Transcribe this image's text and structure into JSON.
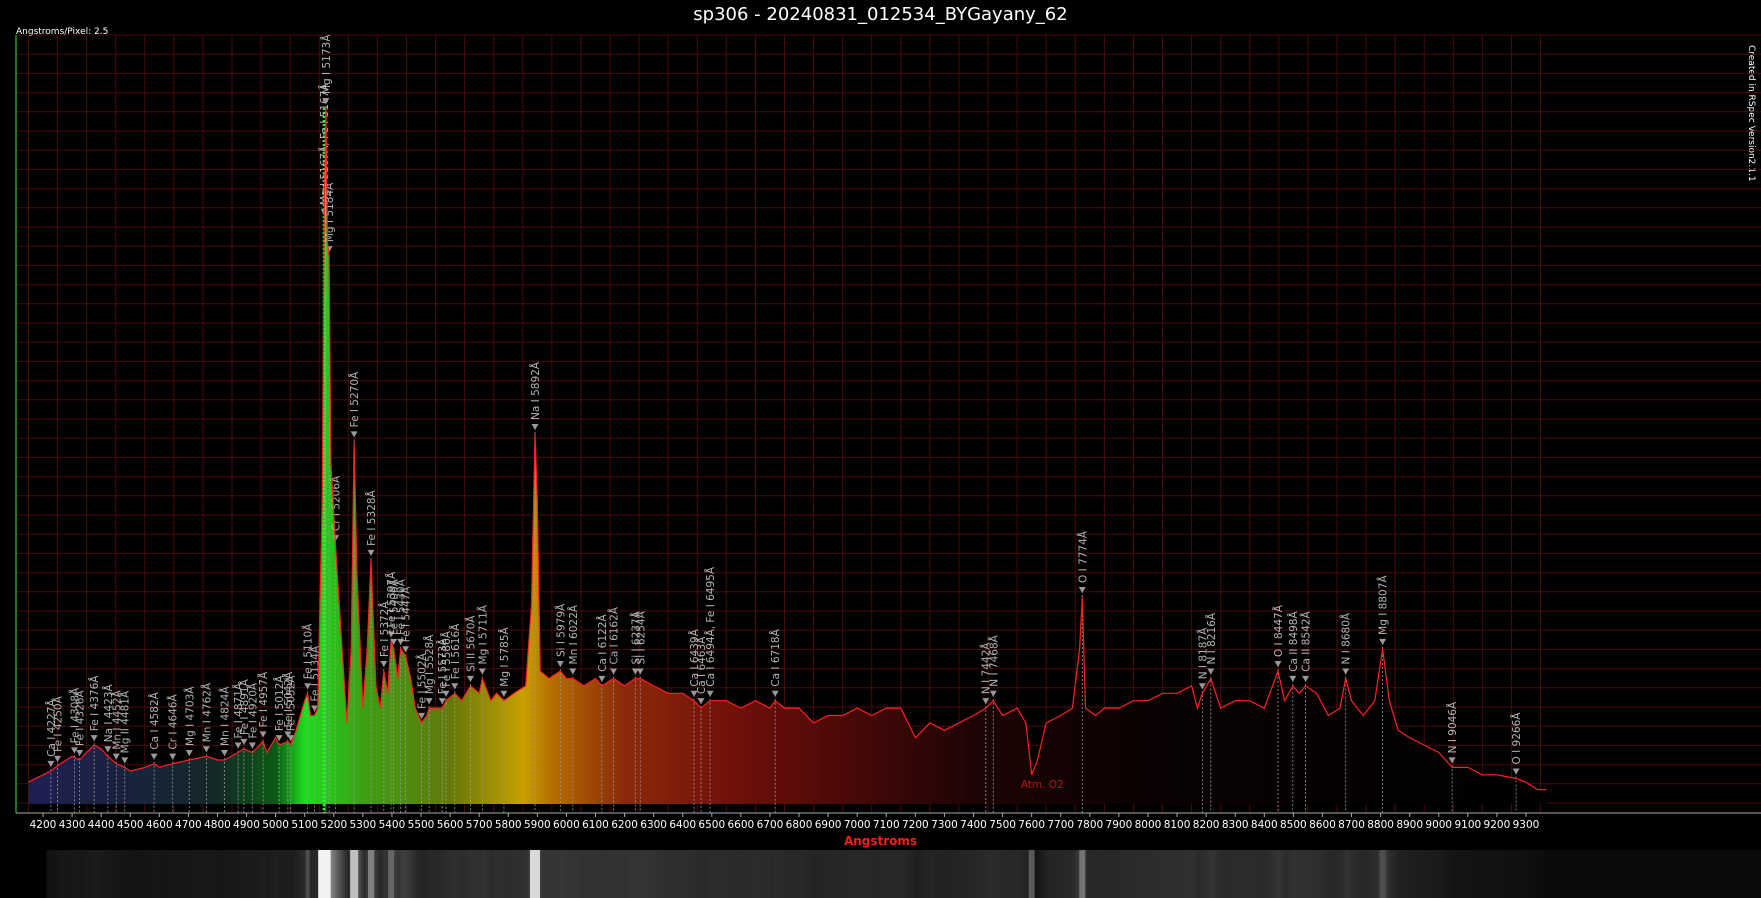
{
  "chart_data": {
    "type": "line",
    "title": "sp306 - 20240831_012534_BYGayany_62",
    "scale_label": "Angstroms/Pixel: 2.5",
    "credit": "Created in RSpec Version2.1.1",
    "xlabel": "Angstroms",
    "ylabel": "",
    "xlim": [
      4200,
      9380
    ],
    "ylim": [
      0,
      1
    ],
    "grid": true,
    "x_ticks": [
      4200,
      4300,
      4400,
      4500,
      4600,
      4700,
      4800,
      4900,
      5000,
      5100,
      5200,
      5300,
      5400,
      5500,
      5600,
      5700,
      5800,
      5900,
      6000,
      6100,
      6200,
      6300,
      6400,
      6500,
      6600,
      6700,
      6800,
      6900,
      7000,
      7100,
      7200,
      7300,
      7400,
      7500,
      7600,
      7700,
      7800,
      7900,
      8000,
      8100,
      8200,
      8300,
      8400,
      8500,
      8600,
      8700,
      8800,
      8900,
      9000,
      9100,
      9200,
      9300
    ],
    "series": [
      {
        "color": "#ff2020",
        "points": [
          [
            4150,
            0.02
          ],
          [
            4200,
            0.03
          ],
          [
            4226,
            0.035
          ],
          [
            4260,
            0.045
          ],
          [
            4300,
            0.055
          ],
          [
            4326,
            0.05
          ],
          [
            4350,
            0.06
          ],
          [
            4376,
            0.07
          ],
          [
            4400,
            0.065
          ],
          [
            4423,
            0.055
          ],
          [
            4452,
            0.045
          ],
          [
            4481,
            0.04
          ],
          [
            4500,
            0.035
          ],
          [
            4550,
            0.04
          ],
          [
            4582,
            0.045
          ],
          [
            4600,
            0.04
          ],
          [
            4646,
            0.045
          ],
          [
            4703,
            0.05
          ],
          [
            4762,
            0.055
          ],
          [
            4800,
            0.05
          ],
          [
            4824,
            0.05
          ],
          [
            4871,
            0.06
          ],
          [
            4891,
            0.065
          ],
          [
            4920,
            0.06
          ],
          [
            4957,
            0.075
          ],
          [
            4970,
            0.06
          ],
          [
            5000,
            0.08
          ],
          [
            5012,
            0.07
          ],
          [
            5042,
            0.075
          ],
          [
            5052,
            0.07
          ],
          [
            5070,
            0.09
          ],
          [
            5100,
            0.13
          ],
          [
            5110,
            0.14
          ],
          [
            5120,
            0.11
          ],
          [
            5134,
            0.11
          ],
          [
            5145,
            0.12
          ],
          [
            5160,
            0.4
          ],
          [
            5167,
            0.78
          ],
          [
            5173,
            0.93
          ],
          [
            5178,
            0.75
          ],
          [
            5184,
            0.73
          ],
          [
            5190,
            0.45
          ],
          [
            5206,
            0.34
          ],
          [
            5225,
            0.22
          ],
          [
            5245,
            0.1
          ],
          [
            5260,
            0.2
          ],
          [
            5270,
            0.48
          ],
          [
            5280,
            0.3
          ],
          [
            5300,
            0.12
          ],
          [
            5315,
            0.2
          ],
          [
            5328,
            0.32
          ],
          [
            5345,
            0.15
          ],
          [
            5360,
            0.12
          ],
          [
            5372,
            0.17
          ],
          [
            5385,
            0.14
          ],
          [
            5397,
            0.21
          ],
          [
            5406,
            0.2
          ],
          [
            5420,
            0.16
          ],
          [
            5430,
            0.2
          ],
          [
            5447,
            0.19
          ],
          [
            5465,
            0.16
          ],
          [
            5480,
            0.12
          ],
          [
            5502,
            0.1
          ],
          [
            5520,
            0.11
          ],
          [
            5528,
            0.12
          ],
          [
            5550,
            0.12
          ],
          [
            5573,
            0.12
          ],
          [
            5586,
            0.13
          ],
          [
            5616,
            0.14
          ],
          [
            5640,
            0.13
          ],
          [
            5670,
            0.15
          ],
          [
            5700,
            0.14
          ],
          [
            5711,
            0.16
          ],
          [
            5740,
            0.13
          ],
          [
            5760,
            0.14
          ],
          [
            5785,
            0.13
          ],
          [
            5820,
            0.14
          ],
          [
            5860,
            0.15
          ],
          [
            5880,
            0.26
          ],
          [
            5892,
            0.49
          ],
          [
            5900,
            0.4
          ],
          [
            5910,
            0.17
          ],
          [
            5940,
            0.16
          ],
          [
            5979,
            0.17
          ],
          [
            6000,
            0.16
          ],
          [
            6022,
            0.16
          ],
          [
            6060,
            0.15
          ],
          [
            6100,
            0.16
          ],
          [
            6122,
            0.15
          ],
          [
            6162,
            0.16
          ],
          [
            6200,
            0.15
          ],
          [
            6237,
            0.16
          ],
          [
            6254,
            0.16
          ],
          [
            6300,
            0.15
          ],
          [
            6350,
            0.14
          ],
          [
            6400,
            0.14
          ],
          [
            6439,
            0.13
          ],
          [
            6463,
            0.12
          ],
          [
            6494,
            0.13
          ],
          [
            6550,
            0.13
          ],
          [
            6600,
            0.12
          ],
          [
            6650,
            0.13
          ],
          [
            6700,
            0.12
          ],
          [
            6718,
            0.13
          ],
          [
            6750,
            0.12
          ],
          [
            6800,
            0.12
          ],
          [
            6850,
            0.1
          ],
          [
            6900,
            0.11
          ],
          [
            6950,
            0.11
          ],
          [
            7000,
            0.12
          ],
          [
            7050,
            0.11
          ],
          [
            7100,
            0.12
          ],
          [
            7150,
            0.12
          ],
          [
            7200,
            0.08
          ],
          [
            7250,
            0.1
          ],
          [
            7300,
            0.09
          ],
          [
            7350,
            0.1
          ],
          [
            7400,
            0.11
          ],
          [
            7442,
            0.12
          ],
          [
            7468,
            0.13
          ],
          [
            7500,
            0.11
          ],
          [
            7550,
            0.12
          ],
          [
            7580,
            0.1
          ],
          [
            7600,
            0.03
          ],
          [
            7620,
            0.05
          ],
          [
            7650,
            0.1
          ],
          [
            7700,
            0.11
          ],
          [
            7740,
            0.12
          ],
          [
            7765,
            0.2
          ],
          [
            7774,
            0.27
          ],
          [
            7785,
            0.12
          ],
          [
            7820,
            0.11
          ],
          [
            7850,
            0.12
          ],
          [
            7900,
            0.12
          ],
          [
            7950,
            0.13
          ],
          [
            8000,
            0.13
          ],
          [
            8050,
            0.14
          ],
          [
            8100,
            0.14
          ],
          [
            8150,
            0.15
          ],
          [
            8170,
            0.12
          ],
          [
            8187,
            0.14
          ],
          [
            8216,
            0.16
          ],
          [
            8250,
            0.12
          ],
          [
            8300,
            0.13
          ],
          [
            8350,
            0.13
          ],
          [
            8400,
            0.12
          ],
          [
            8447,
            0.17
          ],
          [
            8470,
            0.13
          ],
          [
            8498,
            0.15
          ],
          [
            8520,
            0.14
          ],
          [
            8542,
            0.15
          ],
          [
            8580,
            0.14
          ],
          [
            8620,
            0.11
          ],
          [
            8660,
            0.12
          ],
          [
            8680,
            0.16
          ],
          [
            8700,
            0.13
          ],
          [
            8740,
            0.11
          ],
          [
            8780,
            0.13
          ],
          [
            8807,
            0.2
          ],
          [
            8830,
            0.13
          ],
          [
            8860,
            0.09
          ],
          [
            8900,
            0.08
          ],
          [
            8950,
            0.07
          ],
          [
            9000,
            0.06
          ],
          [
            9046,
            0.04
          ],
          [
            9100,
            0.04
          ],
          [
            9150,
            0.03
          ],
          [
            9200,
            0.03
          ],
          [
            9266,
            0.025
          ],
          [
            9300,
            0.02
          ],
          [
            9340,
            0.01
          ],
          [
            9370,
            0.01
          ]
        ]
      }
    ],
    "annotations": [
      {
        "x": 4227,
        "label": "Ca I 4227Å"
      },
      {
        "x": 4250,
        "label": "Fe I 4250Å"
      },
      {
        "x": 4308,
        "label": "Fe I 4308Å"
      },
      {
        "x": 4326,
        "label": "Fe I 4326Å"
      },
      {
        "x": 4376,
        "label": "Fe I 4376Å"
      },
      {
        "x": 4423,
        "label": "Na I 4423Å"
      },
      {
        "x": 4452,
        "label": "Mn I 4452Å"
      },
      {
        "x": 4481,
        "label": "Mg II 4481Å"
      },
      {
        "x": 4582,
        "label": "Ca I 4582Å"
      },
      {
        "x": 4646,
        "label": "Cr I 4646Å"
      },
      {
        "x": 4703,
        "label": "Mg I 4703Å"
      },
      {
        "x": 4762,
        "label": "Mn I 4762Å"
      },
      {
        "x": 4824,
        "label": "Mn I 4824Å"
      },
      {
        "x": 4871,
        "label": "Fe I 4871Å"
      },
      {
        "x": 4891,
        "label": "Fe I 4891Å"
      },
      {
        "x": 4920,
        "label": "Fe I 4920Å"
      },
      {
        "x": 4957,
        "label": "Fe I 4957Å"
      },
      {
        "x": 5012,
        "label": "Fe I 5012Å"
      },
      {
        "x": 5042,
        "label": "Fe I 5042Å"
      },
      {
        "x": 5052,
        "label": "Fe I 5052Å"
      },
      {
        "x": 5110,
        "label": "Fe I 5110Å"
      },
      {
        "x": 5134,
        "label": "Fe I 5134Å"
      },
      {
        "x": 5167,
        "label": "Mg I 5167Å, Fe I 5167Å"
      },
      {
        "x": 5173,
        "label": "Mg I 5173Å"
      },
      {
        "x": 5184,
        "label": "Mg I 5184Å"
      },
      {
        "x": 5206,
        "label": "Cr I 5206Å"
      },
      {
        "x": 5270,
        "label": "Fe I 5270Å"
      },
      {
        "x": 5328,
        "label": "Fe I 5328Å"
      },
      {
        "x": 5372,
        "label": "Fe I 5372Å"
      },
      {
        "x": 5397,
        "label": "Fe I 5397Å"
      },
      {
        "x": 5406,
        "label": "Fe I 5406Å"
      },
      {
        "x": 5430,
        "label": "Fe I 5430Å"
      },
      {
        "x": 5447,
        "label": "Fe I 5447Å"
      },
      {
        "x": 5502,
        "label": "Fe I 5502Å"
      },
      {
        "x": 5528,
        "label": "Mg I 5528Å"
      },
      {
        "x": 5573,
        "label": "Fe I 5573Å"
      },
      {
        "x": 5586,
        "label": "Fe I 5586Å"
      },
      {
        "x": 5616,
        "label": "Fe I 5616Å"
      },
      {
        "x": 5670,
        "label": "Si II 5670Å"
      },
      {
        "x": 5711,
        "label": "Mg I 5711Å"
      },
      {
        "x": 5785,
        "label": "Mg I 5785Å"
      },
      {
        "x": 5892,
        "label": "Na I 5892Å"
      },
      {
        "x": 5979,
        "label": "Si I 5979Å"
      },
      {
        "x": 6022,
        "label": "Mn I 6022Å"
      },
      {
        "x": 6122,
        "label": "Ca I 6122Å"
      },
      {
        "x": 6162,
        "label": "Ca I 6162Å"
      },
      {
        "x": 6237,
        "label": "Si I 6237Å"
      },
      {
        "x": 6254,
        "label": "Si I 6254Å"
      },
      {
        "x": 6439,
        "label": "Ca I 6439Å"
      },
      {
        "x": 6463,
        "label": "Ca I 6463Å"
      },
      {
        "x": 6494,
        "label": "Ca I 6494Å, Fe I 6495Å"
      },
      {
        "x": 6718,
        "label": "Ca I 6718Å"
      },
      {
        "x": 7442,
        "label": "N I 7442Å"
      },
      {
        "x": 7468,
        "label": "N I 7468Å"
      },
      {
        "x": 7774,
        "label": "O I 7774Å"
      },
      {
        "x": 8187,
        "label": "N I 8187Å"
      },
      {
        "x": 8216,
        "label": "N I 8216Å"
      },
      {
        "x": 8447,
        "label": "O I 8447Å"
      },
      {
        "x": 8498,
        "label": "Ca II 8498Å"
      },
      {
        "x": 8542,
        "label": "Ca II 8542Å"
      },
      {
        "x": 8680,
        "label": "N I 8680Å"
      },
      {
        "x": 8807,
        "label": "Mg I 8807Å"
      },
      {
        "x": 9046,
        "label": "N I 9046Å"
      },
      {
        "x": 9266,
        "label": "O I 9266Å"
      }
    ],
    "region_labels": [
      {
        "x": 7640,
        "label": "Atm. O2"
      }
    ],
    "spectrum_strip_bright": [
      {
        "x": 5167,
        "w": 3,
        "b": 0.95
      },
      {
        "x": 5270,
        "w": 2,
        "b": 0.75
      },
      {
        "x": 5328,
        "w": 1.5,
        "b": 0.5
      },
      {
        "x": 5397,
        "w": 1.5,
        "b": 0.4
      },
      {
        "x": 5892,
        "w": 2.5,
        "b": 0.85
      },
      {
        "x": 7774,
        "w": 1.5,
        "b": 0.45
      },
      {
        "x": 7600,
        "w": 1.5,
        "b": 0.35
      },
      {
        "x": 8807,
        "w": 1.5,
        "b": 0.3
      },
      {
        "x": 5110,
        "w": 1,
        "b": 0.3
      }
    ]
  }
}
